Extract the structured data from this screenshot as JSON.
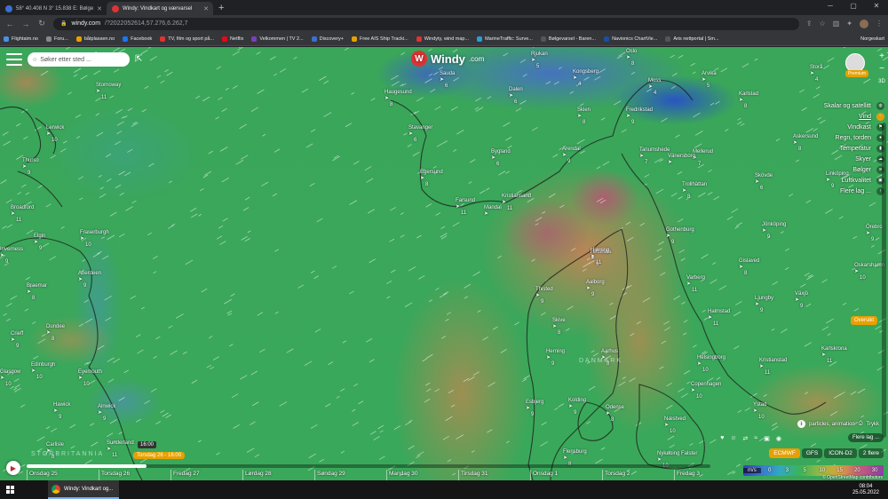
{
  "browser": {
    "tabs": [
      {
        "title": "58° 40.408 N 3° 15.838 E: Bølge",
        "active": false,
        "icon_color": "#3b6fd0"
      },
      {
        "title": "Windy: Vindkart og værvarsel",
        "active": true,
        "icon_color": "#d33"
      }
    ],
    "new_tab": "+",
    "url_host": "windy.com",
    "url_path": "/?2022052614,57.276,6.262,7",
    "bookmarks": [
      {
        "label": "Flightaim.no",
        "color": "#4a90e2"
      },
      {
        "label": "Foru...",
        "color": "#888"
      },
      {
        "label": "båtplassen.no",
        "color": "#e8a000"
      },
      {
        "label": "Facebook",
        "color": "#1877f2"
      },
      {
        "label": "TV, film og sport på...",
        "color": "#d33"
      },
      {
        "label": "Netflix",
        "color": "#e50914"
      },
      {
        "label": "Velkommen | TV 2...",
        "color": "#7b3fb8"
      },
      {
        "label": "Discovery+",
        "color": "#3b6fd0"
      },
      {
        "label": "Free AIS Ship Tracki...",
        "color": "#e8a000"
      },
      {
        "label": "Windyty, wind map...",
        "color": "#d33"
      },
      {
        "label": "MarineTraffic: Surve...",
        "color": "#2d9cdb"
      },
      {
        "label": "Bølgevarsel - Baren...",
        "color": "#555"
      },
      {
        "label": "Navionics ChartVie...",
        "color": "#1b4f9c"
      },
      {
        "label": "Aris nettportal | Sm...",
        "color": "#555"
      }
    ],
    "bookmarks_overflow": "Norgeskart"
  },
  "app": {
    "logo_text": "Windy",
    "logo_suffix": ".com",
    "search_placeholder": "Søker etter sted ...",
    "premium_label": "Premium",
    "zoom_in": "+",
    "zoom_out": "−",
    "view_3d": "3D",
    "layers": [
      {
        "label": "Skalar og satellitt",
        "icon": "satellite-icon",
        "glyph": "◍",
        "active": false
      },
      {
        "label": "Vind",
        "icon": "wind-icon",
        "glyph": "≈",
        "active": true
      },
      {
        "label": "Vindkast",
        "icon": "gust-icon",
        "glyph": "⚑",
        "active": false
      },
      {
        "label": "Regn, torden",
        "icon": "rain-icon",
        "glyph": "●",
        "active": false
      },
      {
        "label": "Temperatur",
        "icon": "thermometer-icon",
        "glyph": "▮",
        "active": false
      },
      {
        "label": "Skyer",
        "icon": "cloud-icon",
        "glyph": "☁",
        "active": false
      },
      {
        "label": "Bølger",
        "icon": "waves-icon",
        "glyph": "≋",
        "active": false
      },
      {
        "label": "Luftkvalitet",
        "icon": "air-quality-icon",
        "glyph": "▣",
        "active": false
      },
      {
        "label": "Flere lag ...",
        "icon": "more-layers-icon",
        "glyph": "‹",
        "active": false
      }
    ],
    "overview_label": "Oversikt",
    "attribution": "particles, animation",
    "print_label": "Trykk",
    "more_layers_label": "Flere lag ...",
    "models": [
      {
        "label": "ECMWF",
        "active": true
      },
      {
        "label": "GFS",
        "active": false
      },
      {
        "label": "ICON-D2",
        "active": false
      },
      {
        "label": "2 flere",
        "active": false
      }
    ],
    "legend_unit": "m/s",
    "legend_values": [
      "0",
      "3",
      "5",
      "10",
      "15",
      "20",
      "30"
    ],
    "copyright": "© OpenStreetMap contributors",
    "watermarks": [
      "STORBRITANNIA",
      "DANMARK"
    ]
  },
  "cities": [
    {
      "name": "Kristiansand",
      "kt": "11"
    },
    {
      "name": "Mandal",
      "kt": ""
    },
    {
      "name": "Farsund",
      "kt": "11"
    },
    {
      "name": "Egersund",
      "kt": "8"
    },
    {
      "name": "Stavanger",
      "kt": "6"
    },
    {
      "name": "Haugesund",
      "kt": "8"
    },
    {
      "name": "Bygland",
      "kt": "6"
    },
    {
      "name": "Dalen",
      "kt": "6"
    },
    {
      "name": "Skien",
      "kt": "8"
    },
    {
      "name": "Arendal",
      "kt": "9"
    },
    {
      "name": "Fredrikstad",
      "kt": "9"
    },
    {
      "name": "Oslo",
      "kt": "8"
    },
    {
      "name": "Kongsberg",
      "kt": "4"
    },
    {
      "name": "Moss",
      "kt": "4"
    },
    {
      "name": "Karlstad",
      "kt": "8"
    },
    {
      "name": "Arvika",
      "kt": "5"
    },
    {
      "name": "Sauda",
      "kt": "6"
    },
    {
      "name": "Rjukan",
      "kt": "5"
    },
    {
      "name": "Tanumshede",
      "kt": "7"
    },
    {
      "name": "Mellerud",
      "kt": "7"
    },
    {
      "name": "Trollhättan",
      "kt": "8"
    },
    {
      "name": "Skövde",
      "kt": "6"
    },
    {
      "name": "Askersund",
      "kt": "8"
    },
    {
      "name": "Linköping",
      "kt": "9"
    },
    {
      "name": "Jönköping",
      "kt": "9"
    },
    {
      "name": "Gothenburg",
      "kt": "9"
    },
    {
      "name": "Varberg",
      "kt": "11"
    },
    {
      "name": "Halmstad",
      "kt": "11"
    },
    {
      "name": "Gislaved",
      "kt": "8"
    },
    {
      "name": "Ljungby",
      "kt": "9"
    },
    {
      "name": "Växjö",
      "kt": "9"
    },
    {
      "name": "Kristianstad",
      "kt": "11"
    },
    {
      "name": "Helsingborg",
      "kt": "10"
    },
    {
      "name": "Copenhagen",
      "kt": "10"
    },
    {
      "name": "Ystad",
      "kt": "10"
    },
    {
      "name": "Hirtshals",
      "kt": "9"
    },
    {
      "name": "Hjørring",
      "kt": "11"
    },
    {
      "name": "Aalborg",
      "kt": "9"
    },
    {
      "name": "Thisted",
      "kt": "9"
    },
    {
      "name": "Skive",
      "kt": "8"
    },
    {
      "name": "Herning",
      "kt": "9"
    },
    {
      "name": "Aarhus",
      "kt": "8"
    },
    {
      "name": "Kolding",
      "kt": "9"
    },
    {
      "name": "Odense",
      "kt": "8"
    },
    {
      "name": "Esbjerg",
      "kt": "9"
    },
    {
      "name": "Næstved",
      "kt": "10"
    },
    {
      "name": "Flensburg",
      "kt": "8"
    },
    {
      "name": "Nykøbing Falster",
      "kt": "10"
    },
    {
      "name": "Lerwick",
      "kt": "10"
    },
    {
      "name": "Stornoway",
      "kt": "11"
    },
    {
      "name": "Thurso",
      "kt": "9"
    },
    {
      "name": "Fraserburgh",
      "kt": "10"
    },
    {
      "name": "Elgin",
      "kt": "9"
    },
    {
      "name": "Aberdeen",
      "kt": "9"
    },
    {
      "name": "Braemar",
      "kt": "8"
    },
    {
      "name": "Dundee",
      "kt": "8"
    },
    {
      "name": "Crieff",
      "kt": "9"
    },
    {
      "name": "Edinburgh",
      "kt": "10"
    },
    {
      "name": "Eyemouth",
      "kt": "10"
    },
    {
      "name": "Alnwick",
      "kt": "9"
    },
    {
      "name": "Hawick",
      "kt": "9"
    },
    {
      "name": "Carlisle",
      "kt": "8"
    },
    {
      "name": "Sunderland",
      "kt": "11"
    },
    {
      "name": "Broadford",
      "kt": "11"
    },
    {
      "name": "Inverness",
      "kt": "9"
    },
    {
      "name": "Glasgow",
      "kt": "10"
    },
    {
      "name": "Vänersborg",
      "kt": ""
    },
    {
      "name": "Storå",
      "kt": "4"
    },
    {
      "name": "Örebro",
      "kt": "9"
    },
    {
      "name": "Oskarshamn",
      "kt": "10"
    },
    {
      "name": "Karlskrona",
      "kt": "11"
    }
  ],
  "timeline": {
    "tooltip_time": "16:00",
    "current_label": "Torsdag 26 - 16:00",
    "progress": 0.175,
    "days": [
      "Onsdag 25",
      "Torsdag 26",
      "Fredag 27",
      "Lørdag 28",
      "Søndag 29",
      "Mandag 30",
      "Tirsdag 31",
      "Onsdag 1",
      "Torsdag 2",
      "Fredag 3"
    ]
  },
  "taskbar": {
    "app_title": "Windy: Vindkart og...",
    "time": "08:04",
    "date": "25.05.2022"
  }
}
